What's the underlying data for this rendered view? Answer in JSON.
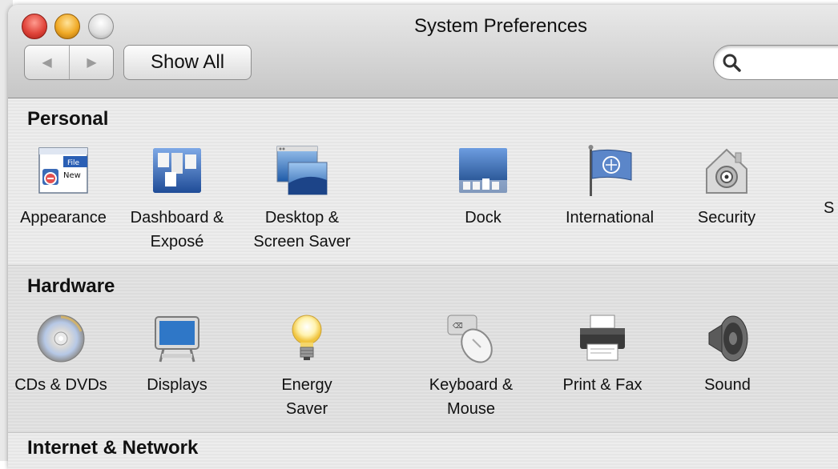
{
  "window": {
    "title": "System Preferences"
  },
  "toolbar": {
    "back_glyph": "◀",
    "forward_glyph": "▶",
    "show_all_label": "Show All",
    "search": {
      "value": "",
      "placeholder": ""
    }
  },
  "sections": {
    "personal": {
      "title": "Personal",
      "items": [
        {
          "label": "Appearance",
          "icon": "appearance-icon"
        },
        {
          "label": "Dashboard &\nExposé",
          "icon": "dashboard-icon"
        },
        {
          "label": "Desktop &\nScreen Saver",
          "icon": "desktop-icon"
        },
        {
          "label": "Dock",
          "icon": "dock-icon"
        },
        {
          "label": "International",
          "icon": "international-icon"
        },
        {
          "label": "Security",
          "icon": "security-icon"
        },
        {
          "label": "S",
          "icon": ""
        }
      ]
    },
    "hardware": {
      "title": "Hardware",
      "items": [
        {
          "label": "CDs & DVDs",
          "icon": "cd-icon"
        },
        {
          "label": "Displays",
          "icon": "display-icon"
        },
        {
          "label": "Energy\nSaver",
          "icon": "bulb-icon"
        },
        {
          "label": "Keyboard &\nMouse",
          "icon": "keyboard-mouse-icon"
        },
        {
          "label": "Print & Fax",
          "icon": "printer-icon"
        },
        {
          "label": "Sound",
          "icon": "speaker-icon"
        }
      ]
    },
    "internet": {
      "title": "Internet & Network"
    }
  },
  "colors": {
    "close": "#e0443a",
    "minimize": "#f0a925",
    "zoom": "#dcdcdc",
    "selection_blue": "#1f5fb8"
  }
}
